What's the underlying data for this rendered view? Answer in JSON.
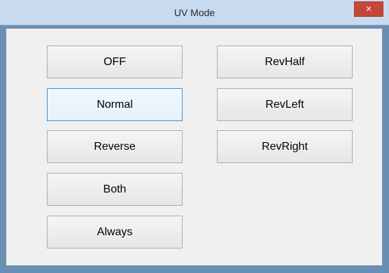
{
  "window": {
    "title": "UV Mode",
    "close_glyph": "×",
    "close_icon": "close-icon"
  },
  "buttons": {
    "left": [
      "OFF",
      "Normal",
      "Reverse",
      "Both",
      "Always"
    ],
    "right": [
      "RevHalf",
      "RevLeft",
      "RevRight"
    ]
  },
  "focused_button": "Normal",
  "colors": {
    "titlebar": "#c8daee",
    "close": "#c7463a",
    "client": "#f0f0f0",
    "focus_border": "#3c8fd6"
  }
}
